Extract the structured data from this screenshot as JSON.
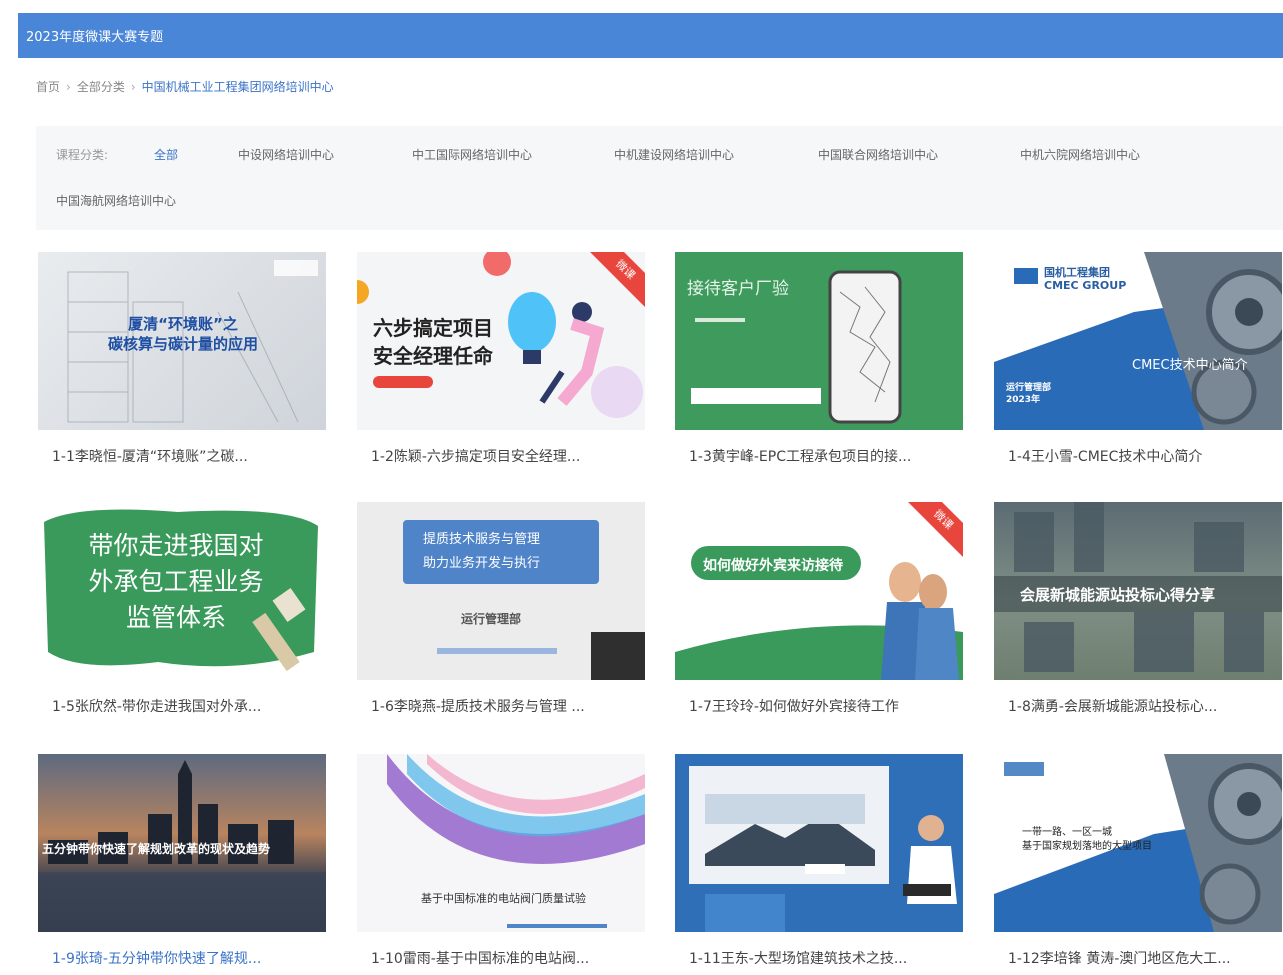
{
  "header": {
    "title": "2023年度微课大赛专题"
  },
  "breadcrumb": {
    "home": "首页",
    "all": "全部分类",
    "current": "中国机械工业工程集团网络培训中心"
  },
  "filter": {
    "label": "课程分类:",
    "options": [
      "全部",
      "中设网络培训中心",
      "中工国际网络培训中心",
      "中机建设网络培训中心",
      "中国联合网络培训中心",
      "中机六院网络培训中心",
      "中国海航网络培训中心"
    ]
  },
  "thumb_texts": {
    "c1_main": "厦清“环境账”之\n碳核算与碳计量的应用",
    "c2_main": "六步搞定项目\n安全经理任命",
    "c2_tag": "微课",
    "c3_main": "接待客户厂验",
    "c4_brand": "国机工程集团\nCMEC GROUP",
    "c4_main": "CMEC技术中心简介",
    "c4_sub": "运行管理部\n2023年",
    "c5_main": "带你走进我国对\n外承包工程业务\n监管体系",
    "c6_main": "提质技术服务与管理\n助力业务开发与执行",
    "c6_sub": "运行管理部",
    "c7_main": "如何做好外宾来访接待",
    "c7_tag": "微课",
    "c8_main": "会展新城能源站投标心得分享",
    "c9_main": "五分钟带你快速了解规划改革的现状及趋势",
    "c10_main": "基于中国标准的电站阀门质量试验",
    "c12_main": "一带一路、一区一城\n基于国家规划落地的大型项目"
  },
  "courses": [
    {
      "title": "1-1李晓恒-厦清“环境账”之碳..."
    },
    {
      "title": "1-2陈颖-六步搞定项目安全经理..."
    },
    {
      "title": "1-3黄宇峰-EPC工程承包项目的接..."
    },
    {
      "title": "1-4王小雪-CMEC技术中心简介"
    },
    {
      "title": "1-5张欣然-带你走进我国对外承..."
    },
    {
      "title": "1-6李晓燕-提质技术服务与管理 ..."
    },
    {
      "title": "1-7王玲玲-如何做好外宾接待工作"
    },
    {
      "title": "1-8满勇-会展新城能源站投标心..."
    },
    {
      "title": "1-9张琦-五分钟带你快速了解规..."
    },
    {
      "title": "1-10雷雨-基于中国标准的电站阀..."
    },
    {
      "title": "1-11王东-大型场馆建筑技术之技..."
    },
    {
      "title": "1-12李培锋 黄涛-澳门地区危大工..."
    }
  ],
  "colors": {
    "header": "#4a86d8",
    "accent": "#3a73c8"
  }
}
